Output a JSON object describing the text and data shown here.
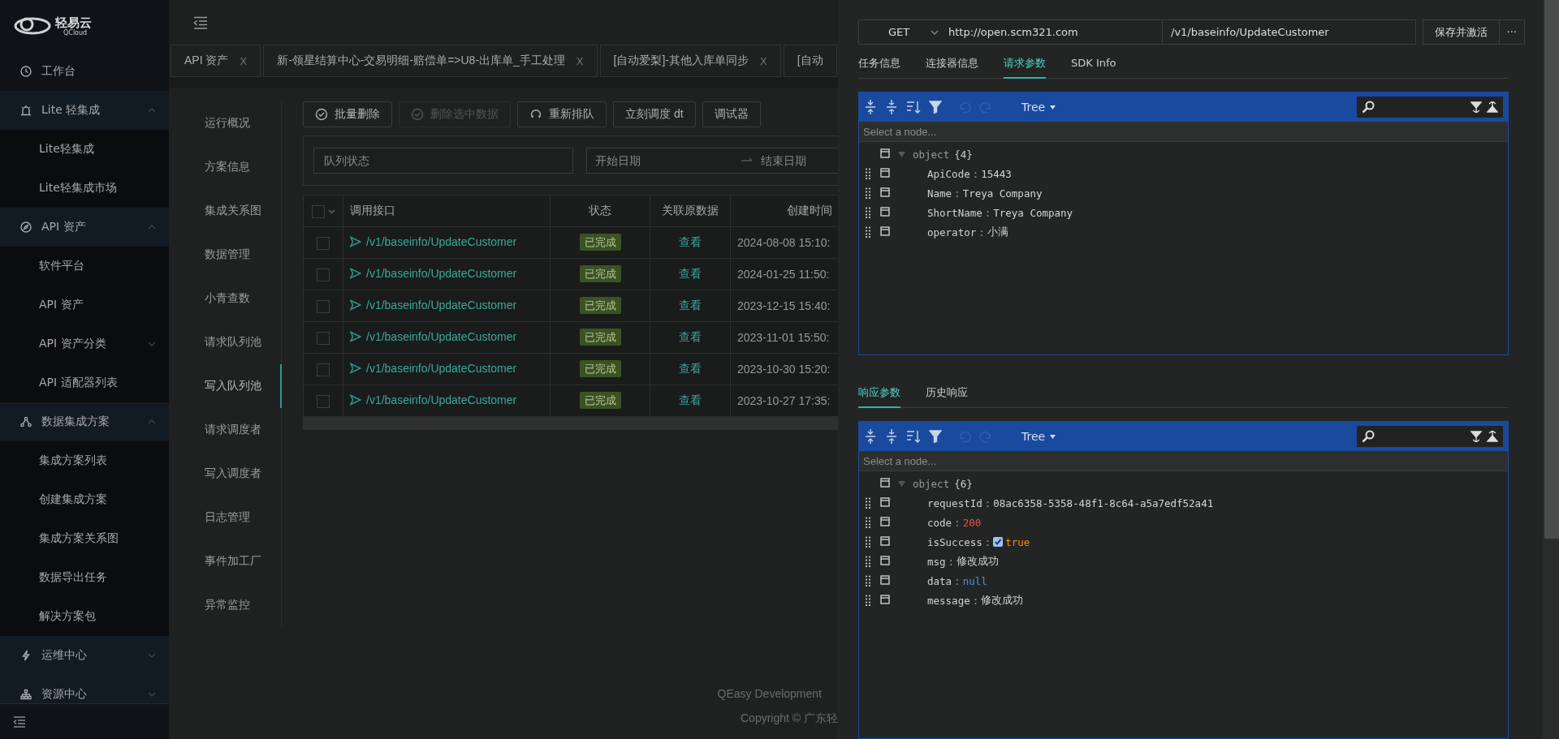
{
  "sidebar": {
    "logo": {
      "name": "轻易云",
      "subtitle": "QCloud"
    },
    "menu": [
      {
        "kind": "link",
        "label": "工作台"
      },
      {
        "kind": "group",
        "label": "Lite 轻集成",
        "expanded": true,
        "children": [
          {
            "kind": "link",
            "label": "Lite轻集成"
          },
          {
            "kind": "link",
            "label": "Lite轻集成市场"
          }
        ]
      },
      {
        "kind": "group",
        "label": "API 资产",
        "expanded": true,
        "children": [
          {
            "kind": "link",
            "label": "软件平台"
          },
          {
            "kind": "link",
            "label": "API 资产"
          },
          {
            "kind": "submenu",
            "label": "API 资产分类"
          },
          {
            "kind": "link",
            "label": "API 适配器列表"
          }
        ]
      },
      {
        "kind": "group",
        "label": "数据集成方案",
        "expanded": true,
        "children": [
          {
            "kind": "link",
            "label": "集成方案列表"
          },
          {
            "kind": "link",
            "label": "创建集成方案"
          },
          {
            "kind": "link",
            "label": "集成方案关系图"
          },
          {
            "kind": "link",
            "label": "数据导出任务"
          },
          {
            "kind": "link",
            "label": "解决方案包"
          }
        ]
      },
      {
        "kind": "group",
        "label": "运维中心",
        "expanded": false
      },
      {
        "kind": "group",
        "label": "资源中心",
        "expanded": false
      }
    ]
  },
  "main": {
    "page_tabs": [
      {
        "label": "API 资产",
        "close": "X"
      },
      {
        "label": "新-领星结算中心-交易明细-赔偿单=>U8-出库单_手工处理",
        "close": "X"
      },
      {
        "label": "[自动爱梨]-其他入库单同步",
        "close": "X"
      },
      {
        "label": "[自动"
      }
    ],
    "side_nav": [
      {
        "label": "运行概况",
        "selected": false
      },
      {
        "label": "方案信息",
        "selected": false
      },
      {
        "label": "集成关系图",
        "selected": false
      },
      {
        "label": "数据管理",
        "selected": false
      },
      {
        "label": "小青查数",
        "selected": false
      },
      {
        "label": "请求队列池",
        "selected": false
      },
      {
        "label": "写入队列池",
        "selected": true
      },
      {
        "label": "请求调度者",
        "selected": false
      },
      {
        "label": "写入调度者",
        "selected": false
      },
      {
        "label": "日志管理",
        "selected": false
      },
      {
        "label": "事件加工厂",
        "selected": false
      },
      {
        "label": "异常监控",
        "selected": false
      }
    ],
    "toolbar": [
      {
        "label": "批量删除",
        "disabled": false
      },
      {
        "label": "删除选中数据",
        "disabled": true
      },
      {
        "label": "重新排队",
        "disabled": false
      },
      {
        "label": "立刻调度 dt",
        "disabled": false
      },
      {
        "label": "调试器",
        "disabled": false
      }
    ],
    "filters": {
      "status": {
        "placeholder": "队列状态"
      },
      "date_range": {
        "start_placeholder": "开始日期",
        "end_placeholder": "结束日期"
      }
    },
    "table": {
      "select_all_checked": false,
      "columns": [
        "调用接口",
        "状态",
        "关联原数据",
        "创建时间"
      ],
      "rows": [
        {
          "checked": false,
          "interface": "/v1/baseinfo/UpdateCustomer",
          "status": "已完成",
          "related": "查看",
          "created": "2024-08-08 15:10:"
        },
        {
          "checked": false,
          "interface": "/v1/baseinfo/UpdateCustomer",
          "status": "已完成",
          "related": "查看",
          "created": "2024-01-25 11:50:"
        },
        {
          "checked": false,
          "interface": "/v1/baseinfo/UpdateCustomer",
          "status": "已完成",
          "related": "查看",
          "created": "2023-12-15 15:40:"
        },
        {
          "checked": false,
          "interface": "/v1/baseinfo/UpdateCustomer",
          "status": "已完成",
          "related": "查看",
          "created": "2023-11-01 15:50:"
        },
        {
          "checked": false,
          "interface": "/v1/baseinfo/UpdateCustomer",
          "status": "已完成",
          "related": "查看",
          "created": "2023-10-30 15:20:"
        },
        {
          "checked": false,
          "interface": "/v1/baseinfo/UpdateCustomer",
          "status": "已完成",
          "related": "查看",
          "created": "2023-10-27 17:35:"
        }
      ]
    },
    "footer": {
      "line_1": "QEasy Development",
      "line_2": "Copyright © 广东轻"
    }
  },
  "drawer": {
    "request": {
      "method": "GET",
      "base_url": "http://open.scm321.com",
      "path": "/v1/baseinfo/UpdateCustomer",
      "save_button": "保存并激活",
      "more_button": "···"
    },
    "tabs": [
      {
        "label": "任务信息",
        "selected": false
      },
      {
        "label": "连接器信息",
        "selected": false
      },
      {
        "label": "请求参数",
        "selected": true
      },
      {
        "label": "SDK Info",
        "selected": false
      }
    ],
    "request_editor": {
      "mode": "Tree",
      "placeholder": "Select a node...",
      "root": {
        "label": "object",
        "count": "{4}"
      },
      "fields": [
        {
          "key": "ApiCode",
          "separator": ":",
          "kind": "string",
          "value": "15443"
        },
        {
          "key": "Name",
          "separator": ":",
          "kind": "string",
          "value": "Treya Company"
        },
        {
          "key": "ShortName",
          "separator": ":",
          "kind": "string",
          "value": "Treya Company"
        },
        {
          "key": "operator",
          "separator": ":",
          "kind": "string",
          "value": "小满"
        }
      ]
    },
    "response_tabs": [
      {
        "label": "响应参数",
        "selected": true
      },
      {
        "label": "历史响应",
        "selected": false
      }
    ],
    "response_editor": {
      "mode": "Tree",
      "placeholder": "Select a node...",
      "root": {
        "label": "object",
        "count": "{6}"
      },
      "fields": [
        {
          "key": "requestId",
          "separator": ":",
          "kind": "string",
          "value": "08ac6358-5358-48f1-8c64-a5a7edf52a41"
        },
        {
          "key": "code",
          "separator": ":",
          "kind": "number",
          "value": "200"
        },
        {
          "key": "isSuccess",
          "separator": ":",
          "kind": "boolean",
          "value": "true",
          "checked": true
        },
        {
          "key": "msg",
          "separator": ":",
          "kind": "string",
          "value": "修改成功"
        },
        {
          "key": "data",
          "separator": ":",
          "kind": "null",
          "value": "null"
        },
        {
          "key": "message",
          "separator": ":",
          "kind": "string",
          "value": "修改成功"
        }
      ]
    }
  }
}
